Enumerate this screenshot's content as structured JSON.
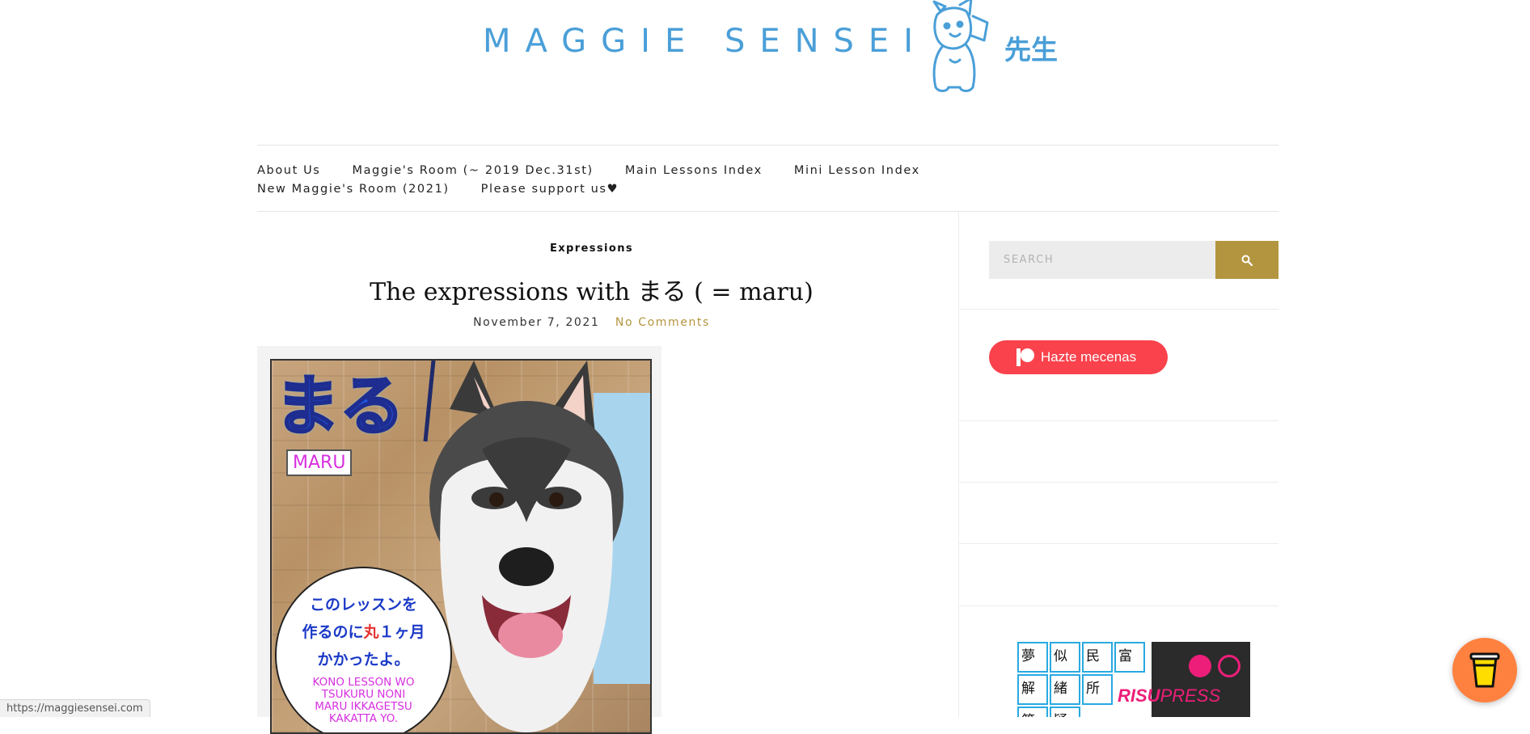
{
  "header": {
    "site_title": "MAGGIE SENSEI",
    "logo_kanji": "先生"
  },
  "nav": {
    "items": [
      "About Us",
      "Maggie's Room (~ 2019 Dec.31st)",
      "Main Lessons Index",
      "Mini Lesson Index",
      "New Maggie's Room (2021)",
      "Please support us♥"
    ]
  },
  "post": {
    "category": "Expressions",
    "title": "The expressions with まる ( = maru)",
    "date": "November 7, 2021",
    "comments": "No Comments",
    "image": {
      "big_kana": "まる",
      "tag": "MARU",
      "bubble_line1": "このレッスンを",
      "bubble_line2_a": "作るのに",
      "bubble_line2_red": "丸",
      "bubble_line2_b": "１ヶ月",
      "bubble_line3": "かかったよ。",
      "romaji_line1": "KONO LESSON WO",
      "romaji_line2": "TSUKURU NONI",
      "romaji_line3": "MARU IKKAGETSU",
      "romaji_line4": "KAKATTA YO."
    }
  },
  "sidebar": {
    "search_placeholder": "SEARCH",
    "patreon_label": "Hazte mecenas",
    "risu": {
      "cells": [
        "夢",
        "似",
        "民",
        "富",
        "解",
        "緒",
        "所",
        "第",
        "疑"
      ],
      "brand_bold": "RISU",
      "brand_light": "PRESS"
    }
  },
  "status_bar": {
    "url": "https://maggiesensei.com"
  },
  "colors": {
    "brand_blue": "#4a9fd8",
    "accent_gold": "#b4953f",
    "patreon_red": "#f9424c",
    "coffee_orange": "#ff813f",
    "risu_pink": "#ed1e79"
  }
}
